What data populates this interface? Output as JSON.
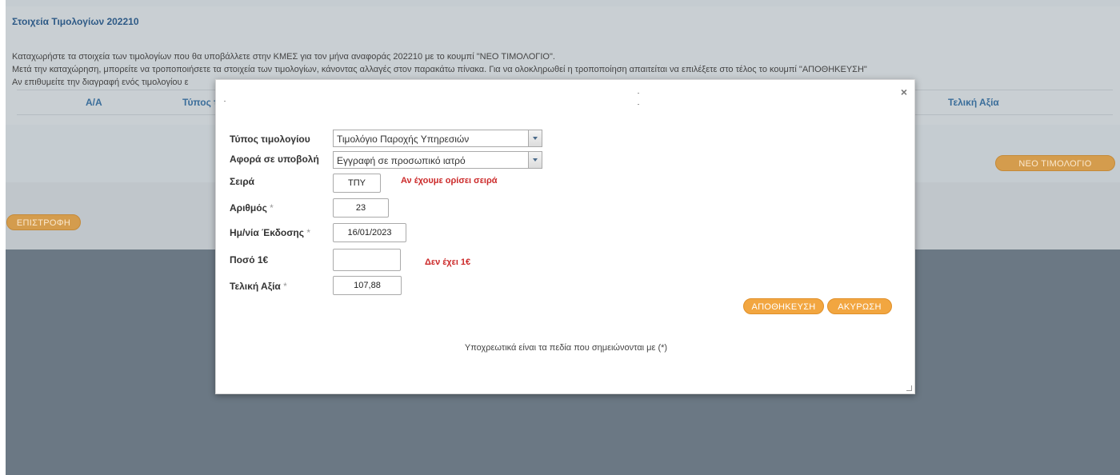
{
  "header": {
    "title": "Στοιχεία Τιμολογίων 202210"
  },
  "intro": {
    "line1": "Καταχωρήστε τα στοιχεία των τιμολογίων που θα υποβάλλετε στην ΚΜΕΣ για τον μήνα αναφοράς 202210 με το κουμπί \"ΝΕΟ ΤΙΜΟΛΟΓΙΟ\".",
    "line2": "Μετά την καταχώρηση, μπορείτε να τροποποιήσετε τα στοιχεία των τιμολογίων, κάνοντας αλλαγές στον παρακάτω πίνακα. Για να ολοκληρωθεί η τροποποίηση απαιτείται να επιλέξετε στο τέλος το κουμπί \"ΑΠΟΘΗΚΕΥΣΗ\"",
    "line3": "Αν επιθυμείτε την διαγραφή ενός τιμολογίου ε"
  },
  "table": {
    "columns": [
      "Α/Α",
      "Τύπος τ",
      "Τελική Αξία"
    ]
  },
  "buttons": {
    "new_invoice": "ΝΕΟ ΤΙΜΟΛΟΓΙΟ",
    "back": "ΕΠΙΣΤΡΟΦΗ"
  },
  "modal": {
    "close_symbol": "×",
    "fields": {
      "invoice_type_label": "Τύπος τιμολογίου",
      "invoice_type_value": "Τιμολόγιο Παροχής Υπηρεσιών",
      "concerns_label": "Αφορά σε υποβολή",
      "concerns_value": "Εγγραφή σε προσωπικό ιατρό",
      "series_label": "Σειρά",
      "series_value": "ΤΠΥ",
      "series_note": "Αν έχουμε ορίσει σειρά",
      "number_label": "Αριθμός",
      "number_value": "23",
      "issue_date_label": "Ημ/νία Έκδοσης",
      "issue_date_value": "16/01/2023",
      "amount_label": "Ποσό 1€",
      "amount_value": "",
      "amount_note": "Δεν έχει 1€",
      "final_value_label": "Τελική Αξία",
      "final_value_value": "107,88",
      "required_mark": "*"
    },
    "save_button": "ΑΠΟΘΗΚΕΥΣΗ",
    "cancel_button": "ΑΚΥΡΩΣΗ",
    "footer_note": "Υποχρεωτικά είναι τα πεδία που σημειώνονται με (*)"
  },
  "colors": {
    "accent_orange": "#f2a640",
    "title_blue": "#2e5a86",
    "note_red": "#cc2a2a",
    "backdrop": "#6b7884"
  }
}
